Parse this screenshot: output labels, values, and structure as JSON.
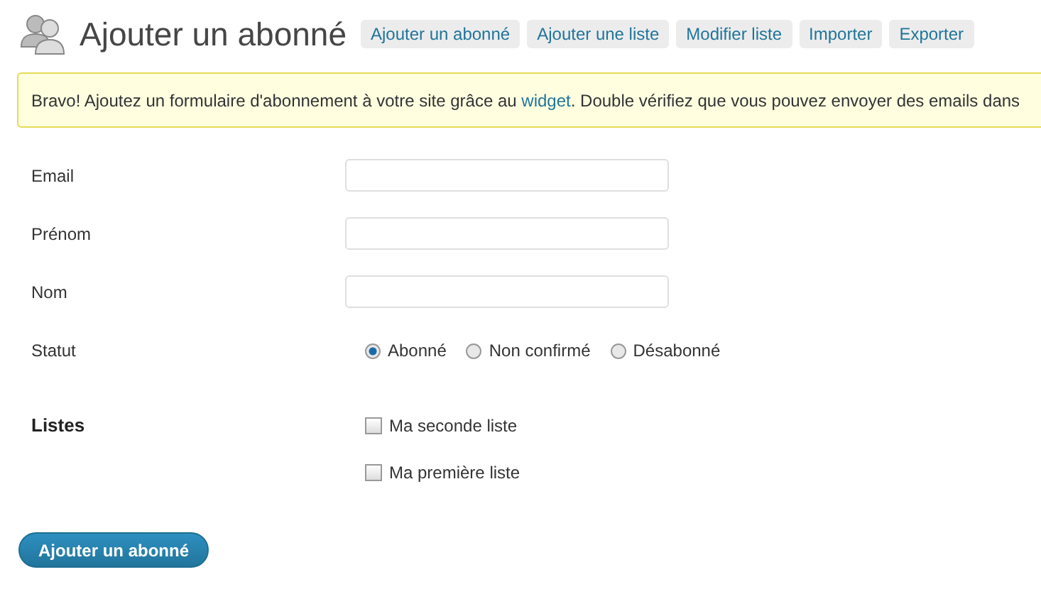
{
  "header": {
    "title": "Ajouter un abonné",
    "nav": [
      {
        "label": "Ajouter un abonné"
      },
      {
        "label": "Ajouter une liste"
      },
      {
        "label": "Modifier liste"
      },
      {
        "label": "Importer"
      },
      {
        "label": "Exporter"
      }
    ]
  },
  "notice": {
    "before": "Bravo! Ajoutez un formulaire d'abonnement à votre site grâce au ",
    "link": "widget",
    "after": ". Double vérifiez que vous pouvez envoyer des emails dans"
  },
  "fields": [
    {
      "label": "Email"
    },
    {
      "label": "Prénom"
    },
    {
      "label": "Nom"
    }
  ],
  "status": {
    "label": "Statut",
    "options": [
      {
        "label": "Abonné",
        "selected": true
      },
      {
        "label": "Non confirmé",
        "selected": false
      },
      {
        "label": "Désabonné",
        "selected": false
      }
    ]
  },
  "lists": {
    "label": "Listes",
    "items": [
      {
        "label": "Ma seconde liste",
        "checked": false
      },
      {
        "label": "Ma première liste",
        "checked": false
      }
    ]
  },
  "submit": "Ajouter un abonné"
}
